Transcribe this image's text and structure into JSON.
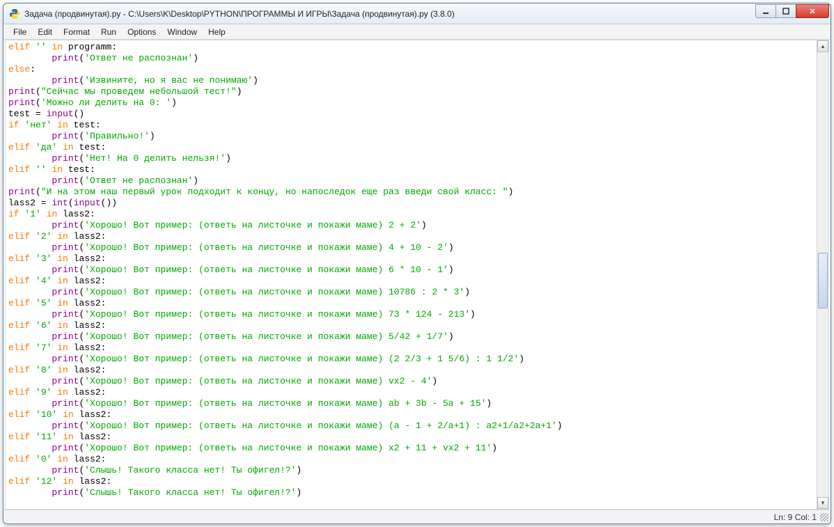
{
  "window": {
    "title": "Задача (продвинутая).py - C:\\Users\\K\\Desktop\\PYTHON\\ПРОГРАММЫ И ИГРЫ\\Задача (продвинутая).py (3.8.0)"
  },
  "menu": {
    "file": "File",
    "edit": "Edit",
    "format": "Format",
    "run": "Run",
    "options": "Options",
    "window": "Window",
    "help": "Help"
  },
  "status": {
    "text": "Ln: 9  Col: 1"
  },
  "code_lines": [
    [
      [
        "kw",
        "elif"
      ],
      [
        "",
        " "
      ],
      [
        "str",
        "''"
      ],
      [
        "",
        " "
      ],
      [
        "kw",
        "in"
      ],
      [
        "",
        " programm:"
      ]
    ],
    [
      [
        "",
        "        "
      ],
      [
        "builtin",
        "print"
      ],
      [
        "",
        "("
      ],
      [
        "str",
        "'Ответ не распознан'"
      ],
      [
        "",
        ")"
      ]
    ],
    [
      [
        "kw",
        "else"
      ],
      [
        "",
        ":"
      ]
    ],
    [
      [
        "",
        "        "
      ],
      [
        "builtin",
        "print"
      ],
      [
        "",
        "("
      ],
      [
        "str",
        "'Извините, но я вас не понимаю'"
      ],
      [
        "",
        ")"
      ]
    ],
    [
      [
        "builtin",
        "print"
      ],
      [
        "",
        "("
      ],
      [
        "str",
        "\"Сейчас мы проведем небольшой тест!\""
      ],
      [
        "",
        ")"
      ]
    ],
    [
      [
        "builtin",
        "print"
      ],
      [
        "",
        "("
      ],
      [
        "str",
        "'Можно ли делить на 0: '"
      ],
      [
        "",
        ")"
      ]
    ],
    [
      [
        "",
        "test = "
      ],
      [
        "builtin",
        "input"
      ],
      [
        "",
        "()"
      ]
    ],
    [
      [
        "kw",
        "if"
      ],
      [
        "",
        " "
      ],
      [
        "str",
        "'нет'"
      ],
      [
        "",
        " "
      ],
      [
        "kw",
        "in"
      ],
      [
        "",
        " test:"
      ]
    ],
    [
      [
        "",
        "        "
      ],
      [
        "builtin",
        "print"
      ],
      [
        "",
        "("
      ],
      [
        "str",
        "'Правильно!'"
      ],
      [
        "",
        ")"
      ]
    ],
    [
      [
        "kw",
        "elif"
      ],
      [
        "",
        " "
      ],
      [
        "str",
        "'да'"
      ],
      [
        "",
        " "
      ],
      [
        "kw",
        "in"
      ],
      [
        "",
        " test:"
      ]
    ],
    [
      [
        "",
        "        "
      ],
      [
        "builtin",
        "print"
      ],
      [
        "",
        "("
      ],
      [
        "str",
        "'Нет! На 0 делить нельзя!'"
      ],
      [
        "",
        ")"
      ]
    ],
    [
      [
        "kw",
        "elif"
      ],
      [
        "",
        " "
      ],
      [
        "str",
        "''"
      ],
      [
        "",
        " "
      ],
      [
        "kw",
        "in"
      ],
      [
        "",
        " test:"
      ]
    ],
    [
      [
        "",
        "        "
      ],
      [
        "builtin",
        "print"
      ],
      [
        "",
        "("
      ],
      [
        "str",
        "'Ответ не распознан'"
      ],
      [
        "",
        ")"
      ]
    ],
    [
      [
        "builtin",
        "print"
      ],
      [
        "",
        "("
      ],
      [
        "str",
        "\"И на этом наш первый урок подходит к концу, но напоследок еще раз введи свой класс: \""
      ],
      [
        "",
        ")"
      ]
    ],
    [
      [
        "",
        "lass2 = "
      ],
      [
        "builtin",
        "int"
      ],
      [
        "",
        "("
      ],
      [
        "builtin",
        "input"
      ],
      [
        "",
        "())"
      ]
    ],
    [
      [
        "kw",
        "if"
      ],
      [
        "",
        " "
      ],
      [
        "str",
        "'1'"
      ],
      [
        "",
        " "
      ],
      [
        "kw",
        "in"
      ],
      [
        "",
        " lass2:"
      ]
    ],
    [
      [
        "",
        "        "
      ],
      [
        "builtin",
        "print"
      ],
      [
        "",
        "("
      ],
      [
        "str",
        "'Хорошо! Вот пример: (ответь на листочке и покажи маме) 2 + 2'"
      ],
      [
        "",
        ")"
      ]
    ],
    [
      [
        "kw",
        "elif"
      ],
      [
        "",
        " "
      ],
      [
        "str",
        "'2'"
      ],
      [
        "",
        " "
      ],
      [
        "kw",
        "in"
      ],
      [
        "",
        " lass2:"
      ]
    ],
    [
      [
        "",
        "        "
      ],
      [
        "builtin",
        "print"
      ],
      [
        "",
        "("
      ],
      [
        "str",
        "'Хорошо! Вот пример: (ответь на листочке и покажи маме) 4 + 10 - 2'"
      ],
      [
        "",
        ")"
      ]
    ],
    [
      [
        "kw",
        "elif"
      ],
      [
        "",
        " "
      ],
      [
        "str",
        "'3'"
      ],
      [
        "",
        " "
      ],
      [
        "kw",
        "in"
      ],
      [
        "",
        " lass2:"
      ]
    ],
    [
      [
        "",
        "        "
      ],
      [
        "builtin",
        "print"
      ],
      [
        "",
        "("
      ],
      [
        "str",
        "'Хорошо! Вот пример: (ответь на листочке и покажи маме) 6 * 10 - 1'"
      ],
      [
        "",
        ")"
      ]
    ],
    [
      [
        "kw",
        "elif"
      ],
      [
        "",
        " "
      ],
      [
        "str",
        "'4'"
      ],
      [
        "",
        " "
      ],
      [
        "kw",
        "in"
      ],
      [
        "",
        " lass2:"
      ]
    ],
    [
      [
        "",
        "        "
      ],
      [
        "builtin",
        "print"
      ],
      [
        "",
        "("
      ],
      [
        "str",
        "'Хорошо! Вот пример: (ответь на листочке и покажи маме) 10786 : 2 * 3'"
      ],
      [
        "",
        ")"
      ]
    ],
    [
      [
        "kw",
        "elif"
      ],
      [
        "",
        " "
      ],
      [
        "str",
        "'5'"
      ],
      [
        "",
        " "
      ],
      [
        "kw",
        "in"
      ],
      [
        "",
        " lass2:"
      ]
    ],
    [
      [
        "",
        "        "
      ],
      [
        "builtin",
        "print"
      ],
      [
        "",
        "("
      ],
      [
        "str",
        "'Хорошо! Вот пример: (ответь на листочке и покажи маме) 73 * 124 - 213'"
      ],
      [
        "",
        ")"
      ]
    ],
    [
      [
        "kw",
        "elif"
      ],
      [
        "",
        " "
      ],
      [
        "str",
        "'6'"
      ],
      [
        "",
        " "
      ],
      [
        "kw",
        "in"
      ],
      [
        "",
        " lass2:"
      ]
    ],
    [
      [
        "",
        "        "
      ],
      [
        "builtin",
        "print"
      ],
      [
        "",
        "("
      ],
      [
        "str",
        "'Хорошо! Вот пример: (ответь на листочке и покажи маме) 5/42 + 1/7'"
      ],
      [
        "",
        ")"
      ]
    ],
    [
      [
        "kw",
        "elif"
      ],
      [
        "",
        " "
      ],
      [
        "str",
        "'7'"
      ],
      [
        "",
        " "
      ],
      [
        "kw",
        "in"
      ],
      [
        "",
        " lass2:"
      ]
    ],
    [
      [
        "",
        "        "
      ],
      [
        "builtin",
        "print"
      ],
      [
        "",
        "("
      ],
      [
        "str",
        "'Хорошо! Вот пример: (ответь на листочке и покажи маме) (2 2/3 + 1 5/6) : 1 1/2'"
      ],
      [
        "",
        ")"
      ]
    ],
    [
      [
        "kw",
        "elif"
      ],
      [
        "",
        " "
      ],
      [
        "str",
        "'8'"
      ],
      [
        "",
        " "
      ],
      [
        "kw",
        "in"
      ],
      [
        "",
        " lass2:"
      ]
    ],
    [
      [
        "",
        "        "
      ],
      [
        "builtin",
        "print"
      ],
      [
        "",
        "("
      ],
      [
        "str",
        "'Хорошо! Вот пример: (ответь на листочке и покажи маме) vx2 - 4'"
      ],
      [
        "",
        ")"
      ]
    ],
    [
      [
        "kw",
        "elif"
      ],
      [
        "",
        " "
      ],
      [
        "str",
        "'9'"
      ],
      [
        "",
        " "
      ],
      [
        "kw",
        "in"
      ],
      [
        "",
        " lass2:"
      ]
    ],
    [
      [
        "",
        "        "
      ],
      [
        "builtin",
        "print"
      ],
      [
        "",
        "("
      ],
      [
        "str",
        "'Хорошо! Вот пример: (ответь на листочке и покажи маме) ab + 3b - 5a + 15'"
      ],
      [
        "",
        ")"
      ]
    ],
    [
      [
        "kw",
        "elif"
      ],
      [
        "",
        " "
      ],
      [
        "str",
        "'10'"
      ],
      [
        "",
        " "
      ],
      [
        "kw",
        "in"
      ],
      [
        "",
        " lass2:"
      ]
    ],
    [
      [
        "",
        "        "
      ],
      [
        "builtin",
        "print"
      ],
      [
        "",
        "("
      ],
      [
        "str",
        "'Хорошо! Вот пример: (ответь на листочке и покажи маме) (a - 1 + 2/a+1) : a2+1/a2+2a+1'"
      ],
      [
        "",
        ")"
      ]
    ],
    [
      [
        "kw",
        "elif"
      ],
      [
        "",
        " "
      ],
      [
        "str",
        "'11'"
      ],
      [
        "",
        " "
      ],
      [
        "kw",
        "in"
      ],
      [
        "",
        " lass2:"
      ]
    ],
    [
      [
        "",
        "        "
      ],
      [
        "builtin",
        "print"
      ],
      [
        "",
        "("
      ],
      [
        "str",
        "'Хорошо! Вот пример: (ответь на листочке и покажи маме) x2 + 11 + vx2 + 11'"
      ],
      [
        "",
        ")"
      ]
    ],
    [
      [
        "kw",
        "elif"
      ],
      [
        "",
        " "
      ],
      [
        "str",
        "'0'"
      ],
      [
        "",
        " "
      ],
      [
        "kw",
        "in"
      ],
      [
        "",
        " lass2:"
      ]
    ],
    [
      [
        "",
        "        "
      ],
      [
        "builtin",
        "print"
      ],
      [
        "",
        "("
      ],
      [
        "str",
        "'Слышь! Такого класса нет! Ты офигел!?'"
      ],
      [
        "",
        ")"
      ]
    ],
    [
      [
        "kw",
        "elif"
      ],
      [
        "",
        " "
      ],
      [
        "str",
        "'12'"
      ],
      [
        "",
        " "
      ],
      [
        "kw",
        "in"
      ],
      [
        "",
        " lass2:"
      ]
    ],
    [
      [
        "",
        "        "
      ],
      [
        "builtin",
        "print"
      ],
      [
        "",
        "("
      ],
      [
        "str",
        "'Слышь! Такого класса нет! Ты офигел!?'"
      ],
      [
        "",
        ")"
      ]
    ]
  ]
}
